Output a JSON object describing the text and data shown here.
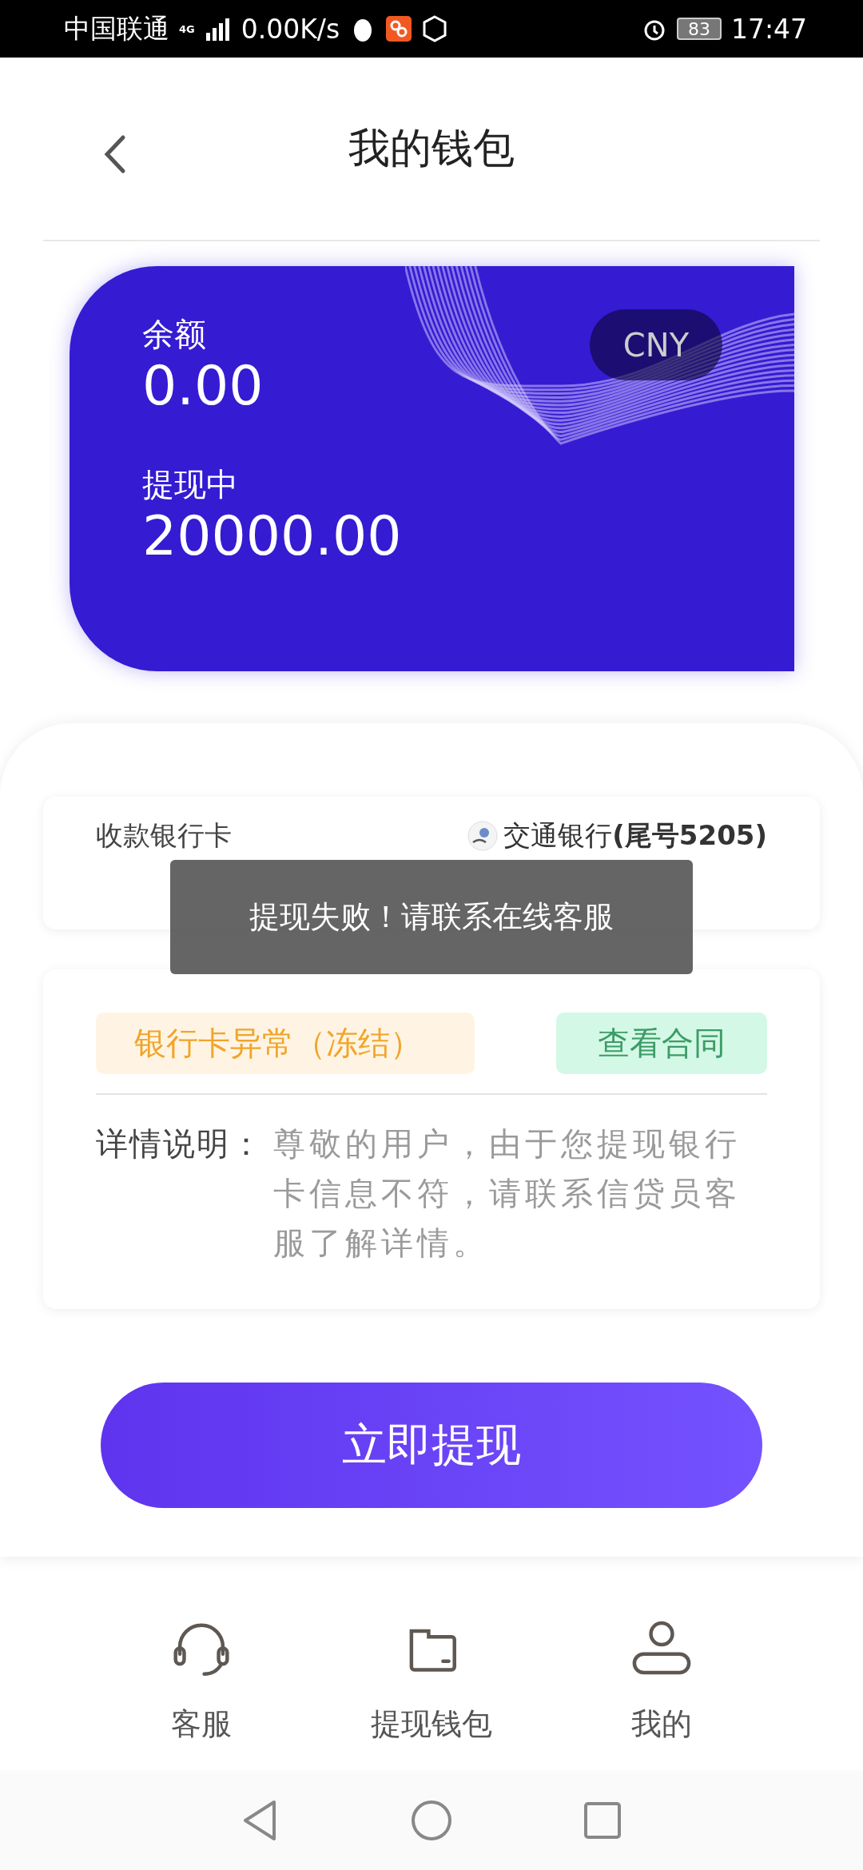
{
  "status_bar": {
    "carrier": "中国联通",
    "network": "4G",
    "speed": "0.00K/s",
    "battery": "83",
    "time": "17:47"
  },
  "header": {
    "title": "我的钱包"
  },
  "wallet_card": {
    "balance_label": "余额",
    "balance": "0.00",
    "pending_label": "提现中",
    "pending": "20000.00",
    "currency": "CNY"
  },
  "bank_card": {
    "label": "收款银行卡",
    "value": "交通银行**(尾号5205)**"
  },
  "toast": {
    "text": "提现失败！请联系在线客服"
  },
  "details": {
    "status_tag": "银行卡异常（冻结）",
    "contract_button": "查看合同",
    "label": "详情说明：",
    "text": "尊敬的用户，由于您提现银行卡信息不符，请联系信贷员客服了解详情。"
  },
  "withdraw_button": {
    "label": "立即提现"
  },
  "tabs": [
    {
      "kind": "headset",
      "label": "客服"
    },
    {
      "kind": "wallet",
      "label": "提现钱包"
    },
    {
      "kind": "user",
      "label": "我的"
    }
  ]
}
